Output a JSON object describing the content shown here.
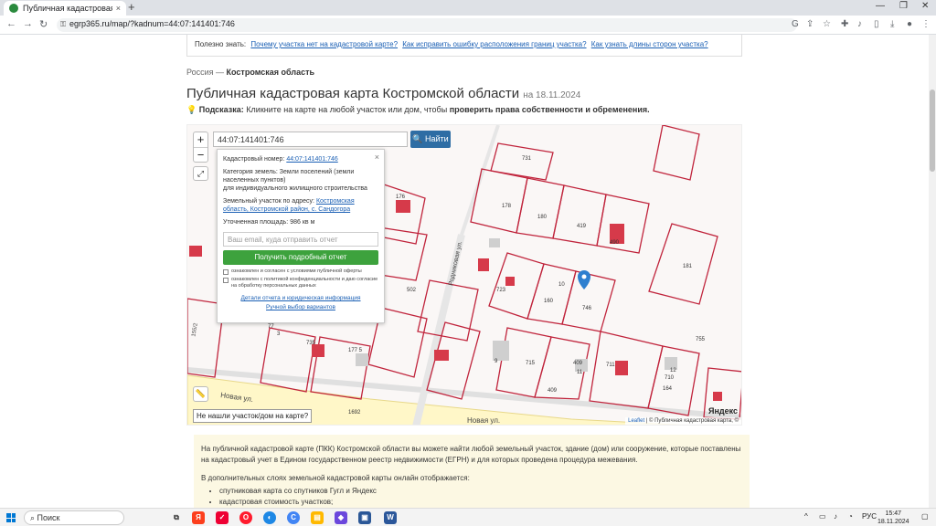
{
  "browser": {
    "tab_title": "Публичная кадастровая карта",
    "tab_close": "×",
    "new_tab": "+",
    "url": "egrp365.ru/map/?kadnum=44:07:141401:746"
  },
  "infobar": {
    "prefix": "Полезно знать:",
    "link1": "Почему участка нет на кадастровой карте?",
    "link2": "Как исправить ошибку расположения границ участка?",
    "link3": "Как узнать длины сторон участка?"
  },
  "breadcrumb": {
    "root": "Россия",
    "sep": "—",
    "current": "Костромская область"
  },
  "page": {
    "title": "Публичная кадастровая карта Костромской области",
    "date": "на 18.11.2024",
    "hint_label": "Подсказка:",
    "hint_text": "Кликните на карте на любой участок или дом, чтобы",
    "hint_bold": "проверить права собственности и обременения."
  },
  "map": {
    "zoom_in": "+",
    "zoom_out": "−",
    "search_value": "44:07:141401:746",
    "find_button": "Найти",
    "not_found": "Не нашли участок/дом на карте?",
    "attribution_leaflet": "Leaflet",
    "attribution_rest": "| © Публичная кадастровая карта, ©",
    "yandex": "Яндекс",
    "street1": "Новая ул.",
    "street2": "Новая ул.",
    "street3": "Родниковая ул.",
    "labels": {
      "l731": "731",
      "l178": "178",
      "l180": "180",
      "l419": "419",
      "l490": "490",
      "l181": "181",
      "l502": "502",
      "l723": "723",
      "l160": "160",
      "l10": "10",
      "l746": "746",
      "l755": "755",
      "l77": "77",
      "l3": "3",
      "l1773": "177 5",
      "l9": "9",
      "l715": "715",
      "l409": "409",
      "l11": "11",
      "l711": "711",
      "l12": "12",
      "l710": "710",
      "l164": "164",
      "l1692": "1692",
      "l155": "155/2",
      "l176": "176",
      "l7357": "735"
    }
  },
  "popup": {
    "close": "×",
    "cad_label": "Кадастровый номер:",
    "cad_value": "44:07:141401:746",
    "cat_label": "Категория земель:",
    "cat_value": "Земли поселений (земли населенных пунктов)",
    "use_value": "для индивидуального жилищного строительства",
    "addr_label": "Земельный участок по адресу:",
    "addr_value": "Костромская область, Костромской район, с. Сандогора",
    "area_label": "Уточненная площадь:",
    "area_value": "986 кв м",
    "email_placeholder": "Ваш email, куда отправить отчет",
    "get_report": "Получить подробный отчет",
    "agree1": "ознакомлен и согласен с условиями публичной оферты",
    "agree2": "ознакомлен с политикой конфиденциальности и даю согласие на обработку персональных данных",
    "details_link": "Детали отчета и юридическая информация",
    "manual_link": "Ручной выбор вариантов"
  },
  "info": {
    "p1": "На публичной кадастровой карте (ПКК) Костромской области вы можете найти любой земельный участок, здание (дом) или сооружение, которые поставлены на кадастровый учет в Едином государственном реестр недвижимости (ЕГРН) и для которых проведена процедура межевания.",
    "p2": "В дополнительных слоях земельной кадастровой карты онлайн отображается:",
    "items": [
      "спутниковая карта со спутников Гугл и Яндекс",
      "кадастровая стоимость участков;"
    ]
  },
  "taskbar": {
    "search": "Поиск",
    "lang": "РУС",
    "time": "15:47",
    "date": "18.11.2024"
  },
  "colors": {
    "parcel_border": "#c0243c",
    "building": "#d63a4a",
    "accent": "#2e6da4",
    "green": "#3da23d"
  }
}
